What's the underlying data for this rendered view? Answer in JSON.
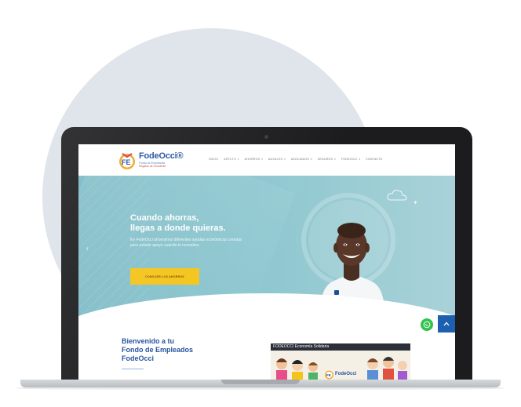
{
  "site": {
    "logo_title": "FodeOcci®",
    "logo_sub1": "Fondo de Empleados",
    "logo_sub2": "Regalos de Occidente"
  },
  "nav": [
    {
      "label": "INICIO",
      "has_caret": false
    },
    {
      "label": "AFECTO",
      "has_caret": true
    },
    {
      "label": "AHORROS",
      "has_caret": true
    },
    {
      "label": "AUXILIOS",
      "has_caret": true
    },
    {
      "label": "ASOCIADOS",
      "has_caret": true
    },
    {
      "label": "SEGUROS",
      "has_caret": true
    },
    {
      "label": "FODEOCCI",
      "has_caret": true
    },
    {
      "label": "CONTACTO",
      "has_caret": false
    }
  ],
  "hero": {
    "title_line1": "Cuando ahorras,",
    "title_line2": "llegas a donde quieras.",
    "text": "En FodeOcci ahorramos diferentes ayudas económicas creadas para estarte apoyo cuando lo necesites.",
    "cta_label": "CONOCER LOS AHORROS",
    "prev_arrow": "‹"
  },
  "welcome": {
    "line1": "Bienvenido a tu",
    "line2": "Fondo de Empleados",
    "line3": "FodeOcci"
  },
  "video": {
    "caption": "FODEOCCI Economía Solidaria",
    "logo_text": "FodeOcci"
  },
  "colors": {
    "brand_blue": "#1f4e9c",
    "hero_teal": "#84c1cb",
    "cta_yellow": "#f4c41a",
    "whatsapp_green": "#32c24d",
    "scroll_top_blue": "#1d5fb0"
  },
  "icons": {
    "whatsapp": "whatsapp-icon",
    "scroll_top": "chevron-up-icon",
    "cloud": "cloud-icon"
  }
}
